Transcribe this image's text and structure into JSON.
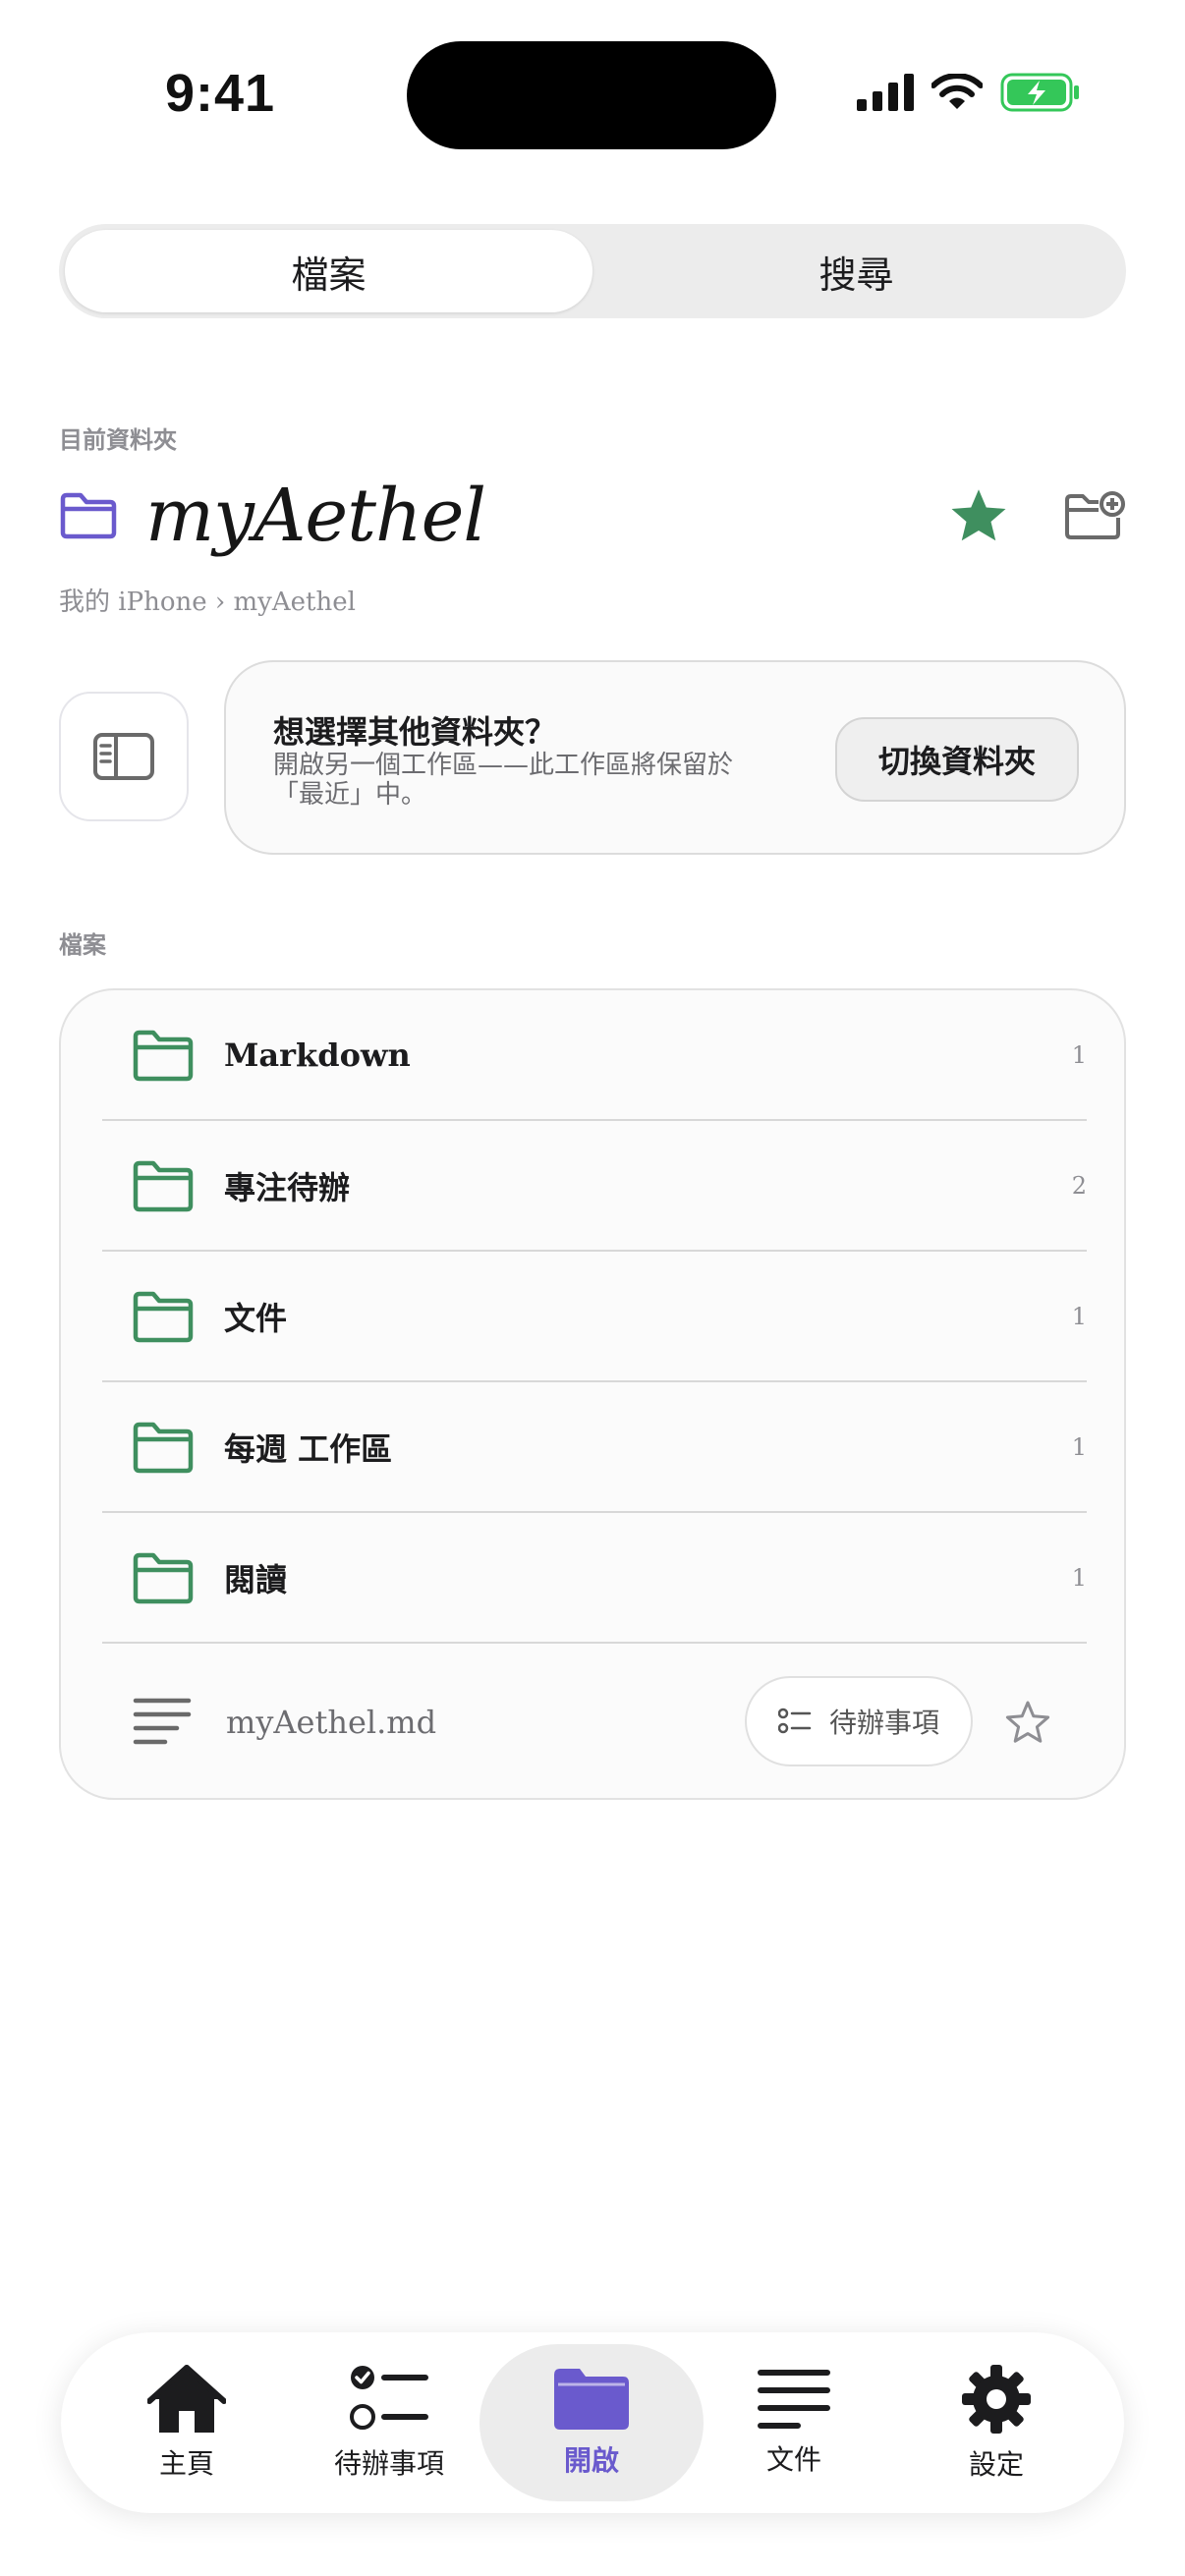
{
  "status": {
    "time": "9:41"
  },
  "segment": {
    "tabs": [
      {
        "label": "檔案"
      },
      {
        "label": "搜尋"
      }
    ]
  },
  "current": {
    "section_label": "目前資料夾",
    "folder_name": "myAethel",
    "breadcrumb": "我的 iPhone › myAethel"
  },
  "switch_card": {
    "title": "想選擇其他資料夾？",
    "description": "開啟另一個工作區——此工作區將保留於「最近」中。",
    "button": "切換資料夾"
  },
  "files": {
    "section_label": "檔案",
    "folders": [
      {
        "name": "Markdown",
        "count": "1"
      },
      {
        "name": "專注待辦",
        "count": "2"
      },
      {
        "name": "文件",
        "count": "1"
      },
      {
        "name": "每週 工作區",
        "count": "1"
      },
      {
        "name": "閱讀",
        "count": "1"
      }
    ],
    "file": {
      "name": "myAethel.md",
      "chip": "待辦事項"
    }
  },
  "tabbar": {
    "items": [
      {
        "label": "主頁",
        "icon": "house-icon"
      },
      {
        "label": "待辦事項",
        "icon": "checklist-icon"
      },
      {
        "label": "開啟",
        "icon": "folder-icon"
      },
      {
        "label": "文件",
        "icon": "document-lines-icon"
      },
      {
        "label": "設定",
        "icon": "gear-icon"
      }
    ]
  },
  "colors": {
    "accent": "#6a5acd",
    "green": "#3f8f5f",
    "battery": "#34c759"
  }
}
